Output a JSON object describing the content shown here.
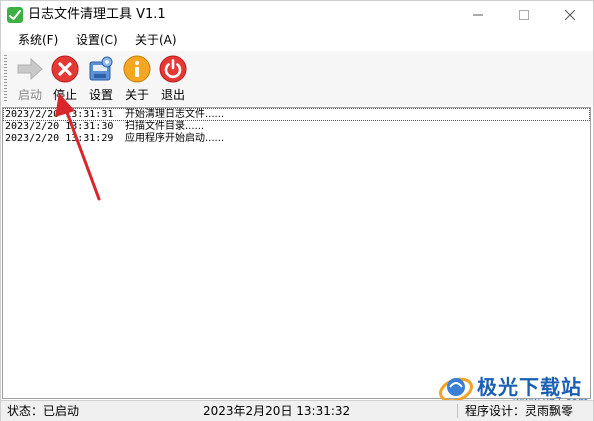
{
  "window": {
    "title": "日志文件清理工具 V1.1"
  },
  "menu": [
    {
      "label": "系统(F)"
    },
    {
      "label": "设置(C)"
    },
    {
      "label": "关于(A)"
    }
  ],
  "toolbar": [
    {
      "label": "启动",
      "icon": "play-arrow-icon",
      "enabled": false
    },
    {
      "label": "停止",
      "icon": "stop-icon",
      "enabled": true
    },
    {
      "label": "设置",
      "icon": "settings-icon",
      "enabled": true
    },
    {
      "label": "关于",
      "icon": "info-icon",
      "enabled": true
    },
    {
      "label": "退出",
      "icon": "power-icon",
      "enabled": true
    }
  ],
  "log": [
    {
      "time": "2023/2/20 13:31:31",
      "message": "开始清理日志文件......"
    },
    {
      "time": "2023/2/20 13:31:30",
      "message": "扫描文件目录......"
    },
    {
      "time": "2023/2/20 13:31:29",
      "message": "应用程序开始启动......"
    }
  ],
  "status": {
    "state": "状态：已启动",
    "datetime": "2023年2月20日   13:31:32",
    "author": "程序设计：灵雨飘零"
  },
  "watermark": {
    "text": "极光下载站",
    "url": "www.xz7.com"
  },
  "colors": {
    "annotation_arrow": "#d9262b",
    "watermark": "#1a5fb4"
  }
}
